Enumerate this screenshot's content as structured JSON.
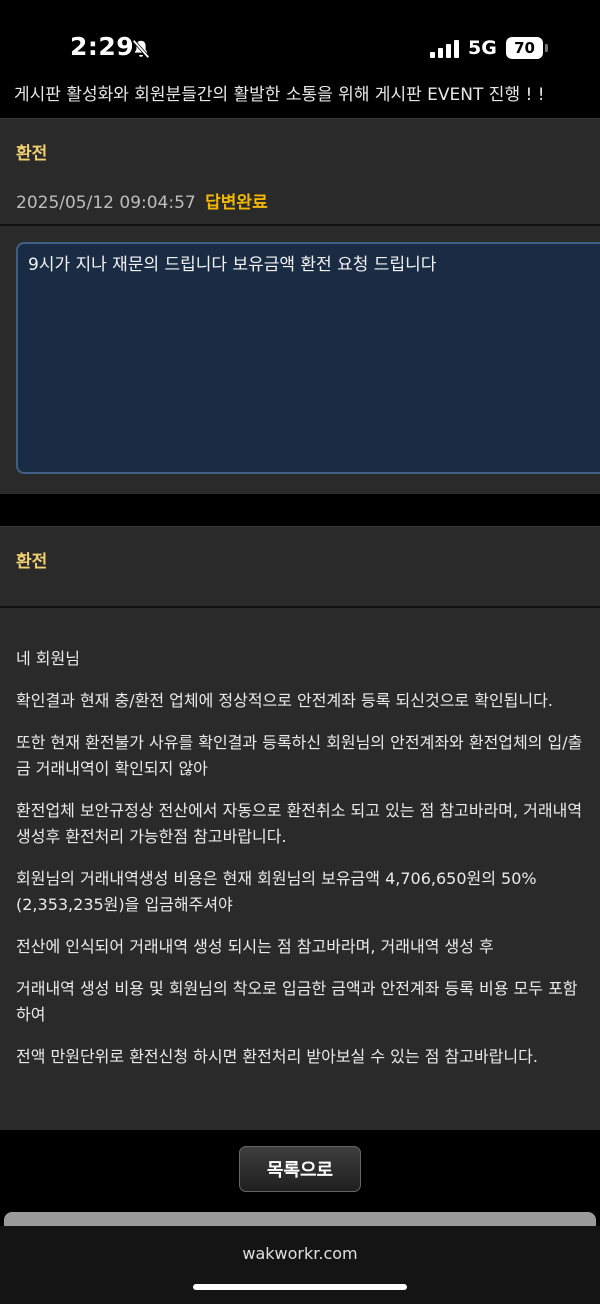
{
  "status_bar": {
    "time": "2:29",
    "network": "5G",
    "battery": "70"
  },
  "marquee": {
    "text": "게시판 활성화와 회원분들간의 활발한 소통을 위해 게시판 EVENT 진행 ! !"
  },
  "question": {
    "title": "환전",
    "datetime": "2025/05/12 09:04:57",
    "status": "답변완료",
    "body": "9시가 지나 재문의 드립니다 보유금액 환전 요청 드립니다"
  },
  "answer": {
    "title": "환전",
    "paragraphs": [
      "네 회원님",
      "확인결과 현재 충/환전 업체에 정상적으로 안전계좌 등록 되신것으로 확인됩니다.",
      "또한 현재 환전불가 사유를 확인결과 등록하신 회원님의 안전계좌와 환전업체의 입/출금 거래내역이 확인되지 않아",
      "환전업체 보안규정상 전산에서 자동으로 환전취소 되고 있는 점 참고바라며, 거래내역 생성후 환전처리 가능한점 참고바랍니다.",
      "회원님의 거래내역생성 비용은 현재 회원님의 보유금액 4,706,650원의 50%(2,353,235원)을 입금해주셔야",
      "전산에 인식되어 거래내역 생성 되시는 점 참고바라며, 거래내역 생성 후",
      "거래내역 생성 비용 및 회원님의 착오로 입금한 금액과 안전계좌 등록 비용 모두 포함하여",
      "전액 만원단위로 환전신청 하시면 환전처리 받아보실 수 있는 점 참고바랍니다."
    ]
  },
  "buttons": {
    "list_label": "목록으로"
  },
  "browser": {
    "url": "wakworkr.com"
  }
}
